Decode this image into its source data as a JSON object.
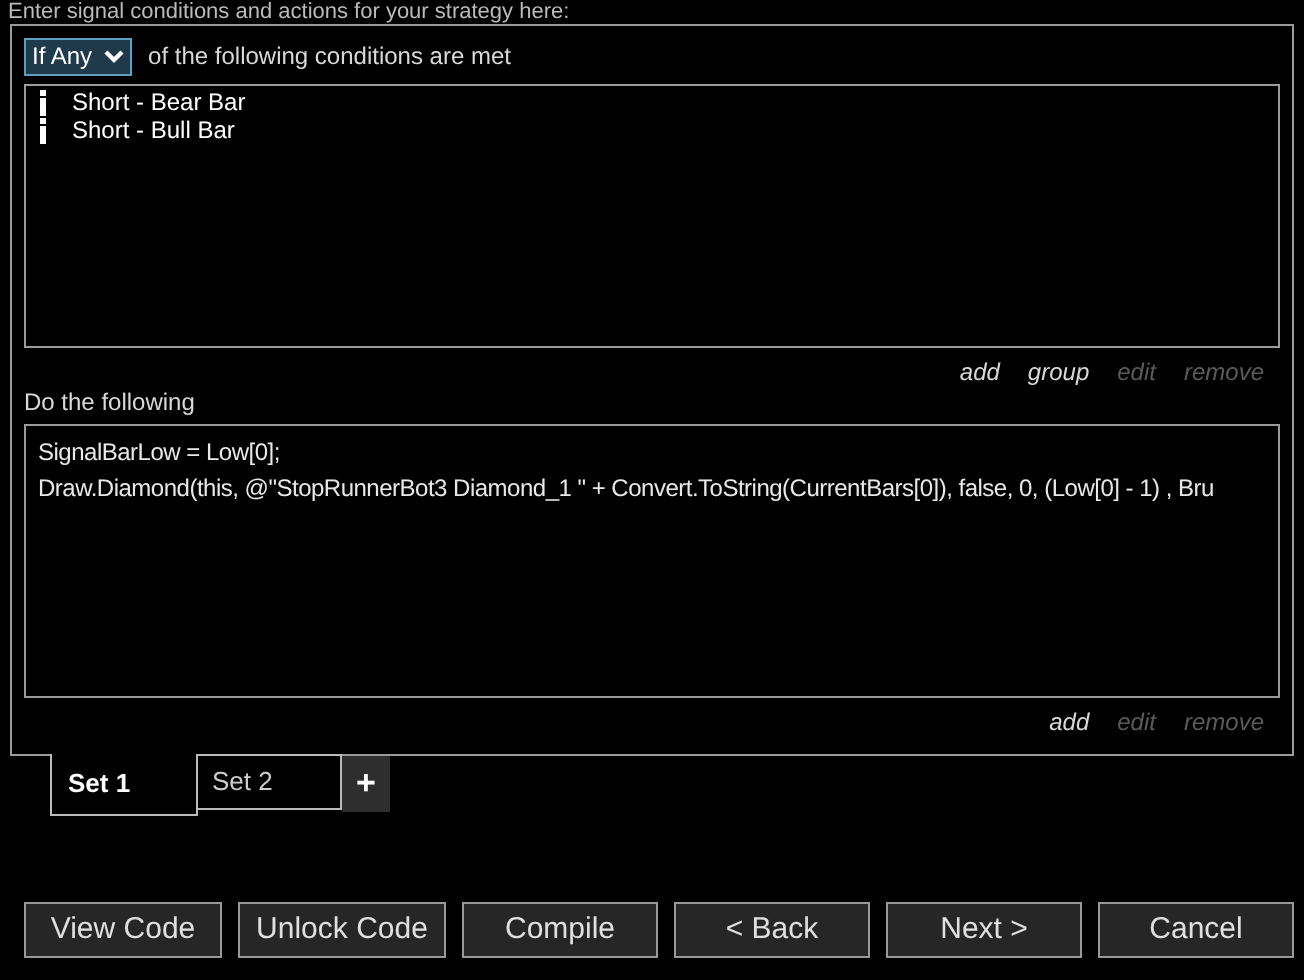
{
  "header": "Enter signal conditions and actions for your strategy here:",
  "conditions": {
    "mode": "If Any",
    "suffix": "of the following conditions are met",
    "items": [
      {
        "label": "Short - Bear Bar"
      },
      {
        "label": "Short - Bull Bar"
      }
    ],
    "links": [
      {
        "label": "add",
        "disabled": false
      },
      {
        "label": "group",
        "disabled": false
      },
      {
        "label": "edit",
        "disabled": true
      },
      {
        "label": "remove",
        "disabled": true
      }
    ]
  },
  "actions": {
    "title": "Do the following",
    "lines": [
      "SignalBarLow = Low[0];",
      "Draw.Diamond(this, @\"StopRunnerBot3 Diamond_1 \" + Convert.ToString(CurrentBars[0]), false, 0, (Low[0] - 1) , Bru"
    ],
    "links": [
      {
        "label": "add",
        "disabled": false
      },
      {
        "label": "edit",
        "disabled": true
      },
      {
        "label": "remove",
        "disabled": true
      }
    ]
  },
  "tabs": [
    {
      "label": "Set 1",
      "selected": true
    },
    {
      "label": "Set 2",
      "selected": false
    }
  ],
  "add_tab": "+",
  "buttons": [
    "View Code",
    "Unlock Code",
    "Compile",
    "< Back",
    "Next >",
    "Cancel"
  ]
}
